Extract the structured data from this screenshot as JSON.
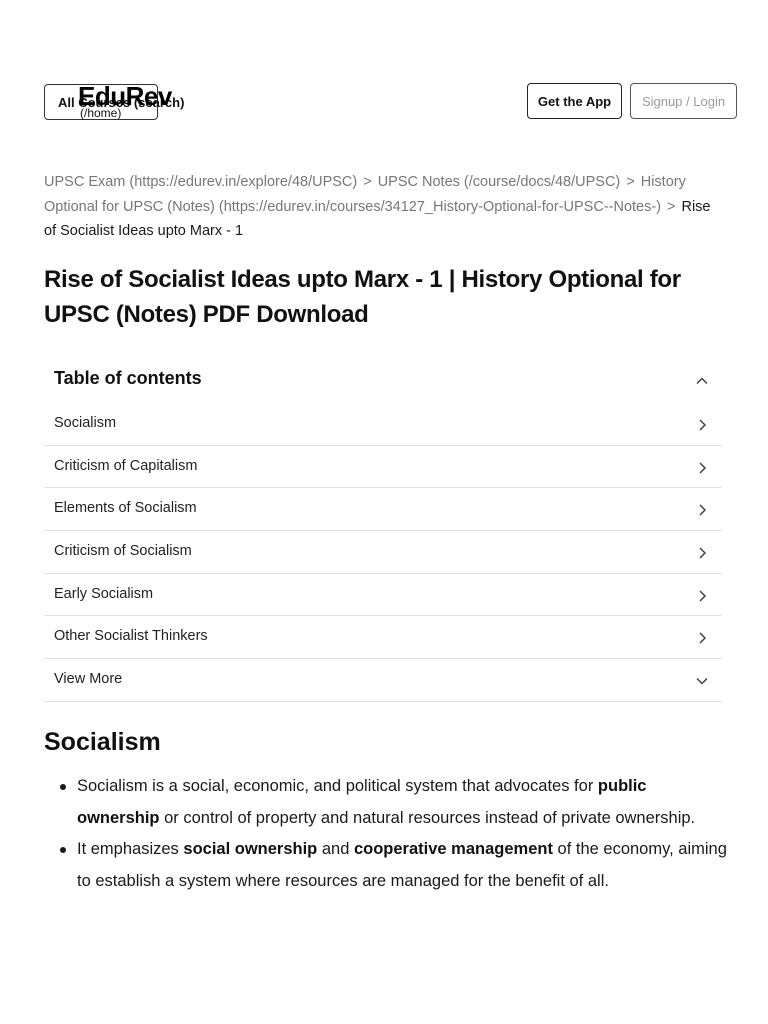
{
  "header": {
    "all_courses_label": "All Courses (search)",
    "logo_text": "EduRev",
    "logo_link": "(/home)",
    "get_app_label": "Get the App",
    "login_label": "Signup / Login"
  },
  "breadcrumb": {
    "items": [
      "UPSC Exam (https://edurev.in/explore/48/UPSC)",
      "UPSC Notes (/course/docs/48/UPSC)",
      "History Optional for UPSC (Notes) (https://edurev.in/courses/34127_History-Optional-for-UPSC--Notes-)"
    ],
    "separator": ">",
    "current": "Rise of Socialist Ideas upto Marx - 1"
  },
  "page_title": "Rise of Socialist Ideas upto Marx - 1 | History Optional for UPSC (Notes) PDF Download",
  "toc": {
    "title": "Table of contents",
    "items": [
      "Socialism",
      "Criticism of Capitalism",
      "Elements of Socialism",
      "Criticism of Socialism",
      "Early Socialism",
      "Other Socialist Thinkers"
    ],
    "view_more": "View More"
  },
  "content": {
    "heading": "Socialism",
    "bullet1": {
      "text_a": "Socialism is a social, economic, and political system that advocates for ",
      "bold_a": "public ownership",
      "text_b": " or control of property and natural resources instead of private ownership."
    },
    "bullet2": {
      "text_a": "It emphasizes ",
      "bold_a": "social ownership",
      "text_b": " and ",
      "bold_b": "cooperative management",
      "text_c": " of the economy, aiming to establish a system where resources are managed for the benefit of all."
    }
  },
  "colors": {
    "text": "#1a1a1a",
    "muted": "#777777",
    "border": "#e2e2e2"
  },
  "icons": {
    "toc_toggle": "chevron-up-icon",
    "toc_item": "chevron-right-icon",
    "view_more": "chevron-down-icon"
  }
}
